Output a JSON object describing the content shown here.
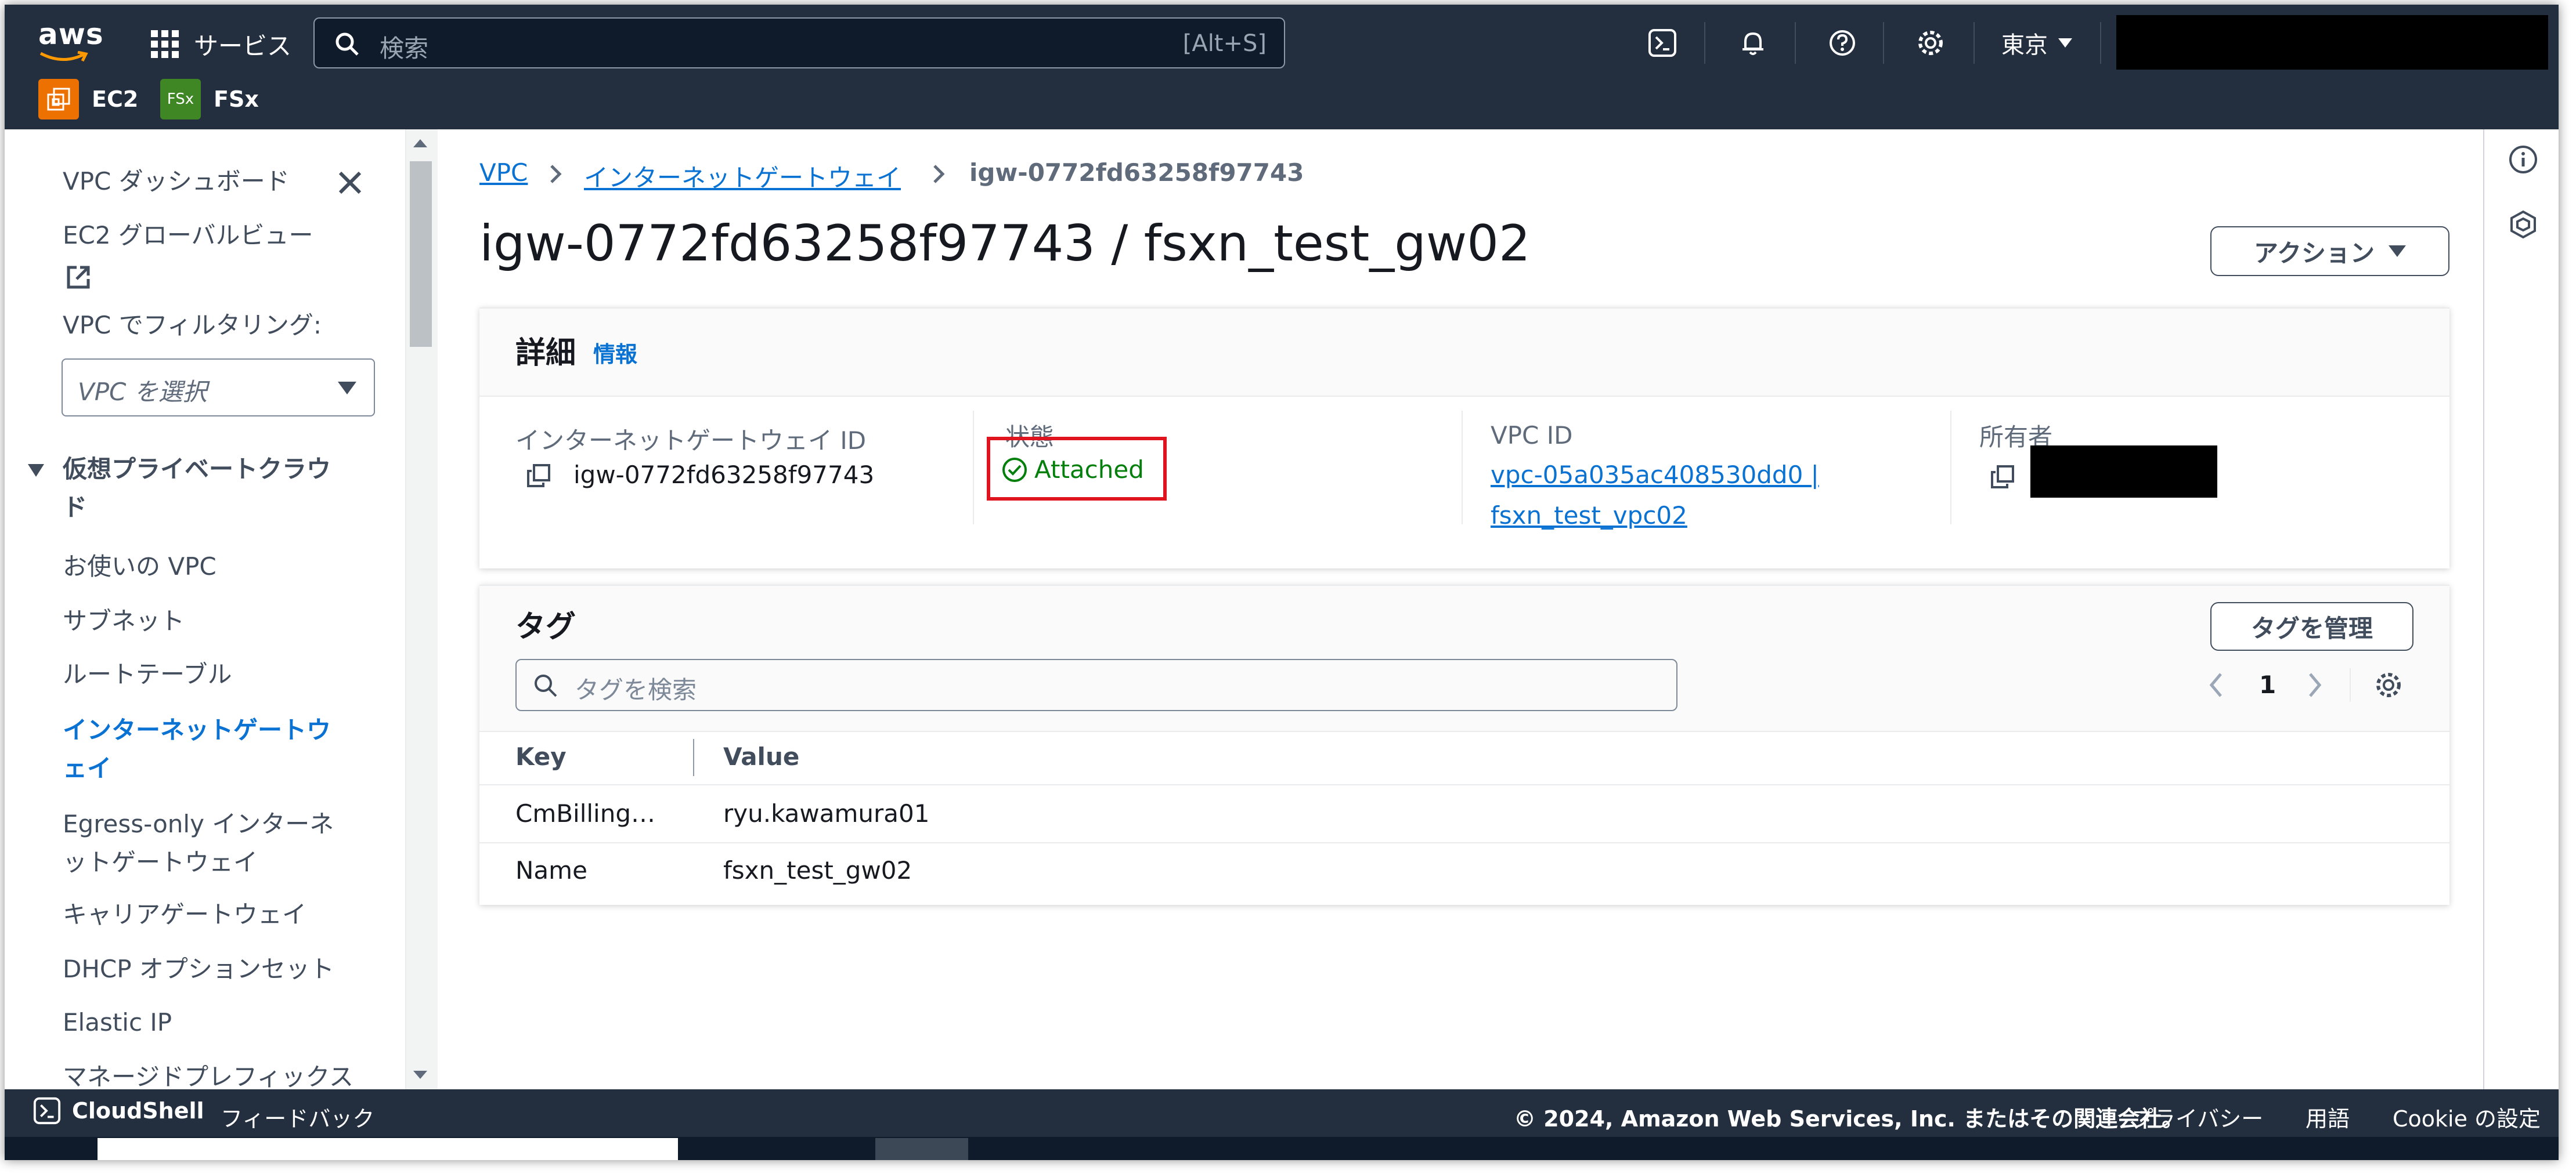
{
  "topnav": {
    "logo_text": "aws",
    "services_label": "サービス",
    "search_placeholder": "検索",
    "search_shortcut": "[Alt+S]",
    "region_label": "東京",
    "favorites": [
      {
        "label": "EC2",
        "icon": "ec2-icon",
        "color": "#ed7100"
      },
      {
        "label": "FSx",
        "icon_text": "FSx",
        "color": "#3f8624"
      }
    ],
    "icons": [
      "cloudshell-icon",
      "bell-icon",
      "help-icon",
      "settings-icon"
    ]
  },
  "sidebar": {
    "dashboard": "VPC ダッシュボード",
    "global_view": "EC2 グローバルビュー",
    "filter_label": "VPC でフィルタリング:",
    "filter_placeholder": "VPC を選択",
    "section_title": "仮想プライベートクラウド",
    "items": [
      {
        "label": "お使いの VPC"
      },
      {
        "label": "サブネット"
      },
      {
        "label": "ルートテーブル"
      },
      {
        "label": "インターネットゲートウェイ",
        "active": true
      },
      {
        "label": "Egress-only インターネットゲートウェイ"
      },
      {
        "label": "キャリアゲートウェイ"
      },
      {
        "label": "DHCP オプションセット"
      },
      {
        "label": "Elastic IP"
      },
      {
        "label": "マネージドプレフィックス"
      }
    ]
  },
  "breadcrumb": {
    "root": "VPC",
    "parent": "インターネットゲートウェイ",
    "current": "igw-0772fd63258f97743"
  },
  "page": {
    "title": "igw-0772fd63258f97743 / fsxn_test_gw02",
    "actions_label": "アクション"
  },
  "details": {
    "title": "詳細",
    "info": "情報",
    "igw_id_label": "インターネットゲートウェイ ID",
    "igw_id": "igw-0772fd63258f97743",
    "state_label": "状態",
    "state": "Attached",
    "vpc_id_label": "VPC ID",
    "vpc_id_line1": "vpc-05a035ac408530dd0 |",
    "vpc_id_line2": "fsxn_test_vpc02",
    "owner_label": "所有者"
  },
  "tags": {
    "title": "タグ",
    "manage_label": "タグを管理",
    "search_placeholder": "タグを検索",
    "page_number": "1",
    "columns": [
      "Key",
      "Value"
    ],
    "rows": [
      {
        "key": "CmBilling…",
        "value": "ryu.kawamura01"
      },
      {
        "key": "Name",
        "value": "fsxn_test_gw02"
      }
    ]
  },
  "footer": {
    "cloudshell": "CloudShell",
    "feedback": "フィードバック",
    "copyright": "© 2024, Amazon Web Services, Inc. またはその関連会社。",
    "privacy": "プライバシー",
    "terms": "用語",
    "cookie": "Cookie の設定"
  },
  "colors": {
    "nav_bg": "#232f3e",
    "link": "#0972d3",
    "success": "#037f0c",
    "highlight": "#e0141e"
  }
}
